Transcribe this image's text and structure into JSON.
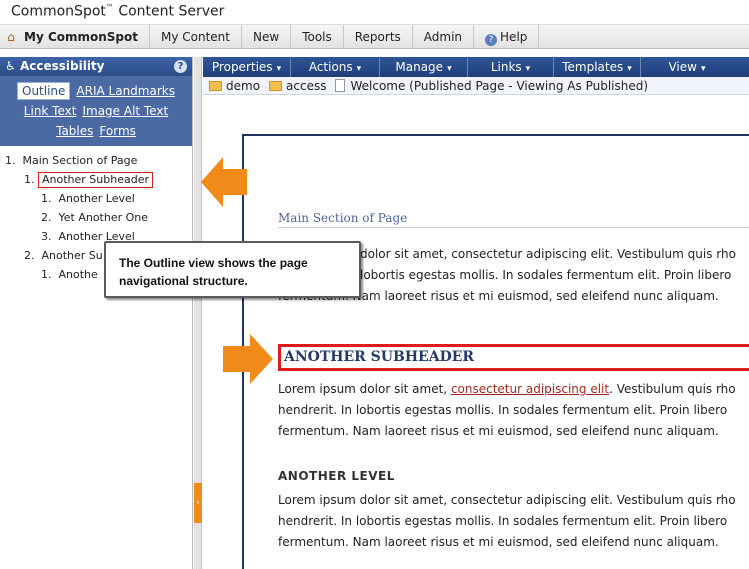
{
  "app": {
    "brand": "CommonSpot",
    "brand_tm": "™",
    "brand_suffix": " Content Server"
  },
  "menubar": {
    "items": [
      "My CommonSpot",
      "My Content",
      "New",
      "Tools",
      "Reports",
      "Admin",
      "Help"
    ]
  },
  "left_panel": {
    "title": "Accessibility",
    "tabs": [
      "Outline",
      "ARIA Landmarks",
      "Link Text",
      "Image Alt Text",
      "Tables",
      "Forms"
    ],
    "active_tab": "Outline",
    "outline": [
      {
        "num": "1.",
        "label": "Main Section of Page",
        "level": 0
      },
      {
        "num": "1.",
        "label": "Another Subheader",
        "level": 1,
        "selected": true
      },
      {
        "num": "1.",
        "label": "Another Level",
        "level": 2
      },
      {
        "num": "2.",
        "label": "Yet Another One",
        "level": 2
      },
      {
        "num": "3.",
        "label": "Another Level",
        "level": 2
      },
      {
        "num": "2.",
        "label": "Another Su",
        "level": 1
      },
      {
        "num": "1.",
        "label": "Anothe",
        "level": 2
      }
    ]
  },
  "toolbar": {
    "items": [
      "Properties",
      "Actions",
      "Manage",
      "Links",
      "Templates",
      "View"
    ]
  },
  "breadcrumb": {
    "items": [
      "demo",
      "access"
    ],
    "page": "Welcome (Published Page - Viewing As Published)"
  },
  "document": {
    "section_title": "Main Section of Page",
    "para1": [
      "dolor sit amet, consectetur adipiscing elit. Vestibulum quis rho",
      "lobortis egestas mollis. In sodales fermentum elit. Proin libero",
      "fermentum. Nam laoreet risus et mi euismod, sed eleifend nunc aliquam."
    ],
    "subheader": "ANOTHER SUBHEADER",
    "para2_prefix": "Lorem ipsum dolor sit amet, ",
    "para2_link": "consectetur adipiscing elit",
    "para2_suffix": ". Vestibulum quis rho",
    "para2_rest": [
      "hendrerit. In lobortis egestas mollis. In sodales fermentum elit. Proin libero",
      "fermentum. Nam laoreet risus et mi euismod, sed eleifend nunc aliquam."
    ],
    "level_heading": "ANOTHER LEVEL",
    "para3": [
      "Lorem ipsum dolor sit amet, consectetur adipiscing elit. Vestibulum quis rho",
      "hendrerit. In lobortis egestas mollis. In sodales fermentum elit. Proin libero",
      "fermentum. Nam laoreet risus et mi euismod, sed eleifend nunc aliquam."
    ]
  },
  "callout": {
    "text": "The Outline view shows the page navigational structure."
  },
  "colors": {
    "accent_orange": "#f08a18",
    "highlight_red": "#e01b1b",
    "toolbar_blue": "#2f5597"
  }
}
